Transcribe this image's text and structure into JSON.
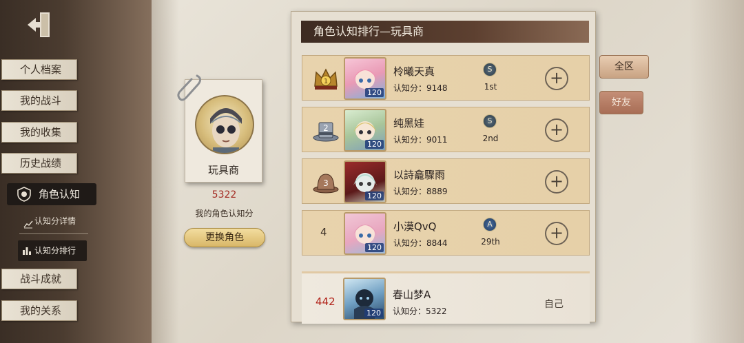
{
  "sidebar": {
    "items": [
      {
        "label": "个人档案"
      },
      {
        "label": "我的战斗"
      },
      {
        "label": "我的收集"
      },
      {
        "label": "历史战绩"
      }
    ],
    "active": {
      "label": "角色认知"
    },
    "sub_items": [
      {
        "label": "认知分详情"
      },
      {
        "label": "认知分排行"
      }
    ],
    "items_after": [
      {
        "label": "战斗成就"
      },
      {
        "label": "我的关系"
      }
    ]
  },
  "profile": {
    "name": "玩具商",
    "score": "5322",
    "score_label": "我的角色认知分",
    "change_button": "更换角色"
  },
  "ranking": {
    "title": "角色认知排行—玩具商",
    "rows": [
      {
        "rank": "1",
        "name": "柃曦天真",
        "score": "认知分：9148",
        "tier": "1st",
        "level": "120",
        "emblem": "S"
      },
      {
        "rank": "2",
        "name": "纯黑娃",
        "score": "认知分：9011",
        "tier": "2nd",
        "level": "120",
        "emblem": "S"
      },
      {
        "rank": "3",
        "name": "以詩龕驟雨",
        "score": "认知分：8889",
        "tier": "",
        "level": "120",
        "emblem": ""
      },
      {
        "rank": "4",
        "name": "小漠QvQ",
        "score": "认知分：8844",
        "tier": "29th",
        "level": "120",
        "emblem": "A"
      }
    ],
    "self": {
      "rank": "442",
      "name": "春山梦A",
      "score": "认知分：5322",
      "tag": "自己",
      "level": "120"
    }
  },
  "tabs": {
    "all": "全区",
    "friends": "好友"
  }
}
